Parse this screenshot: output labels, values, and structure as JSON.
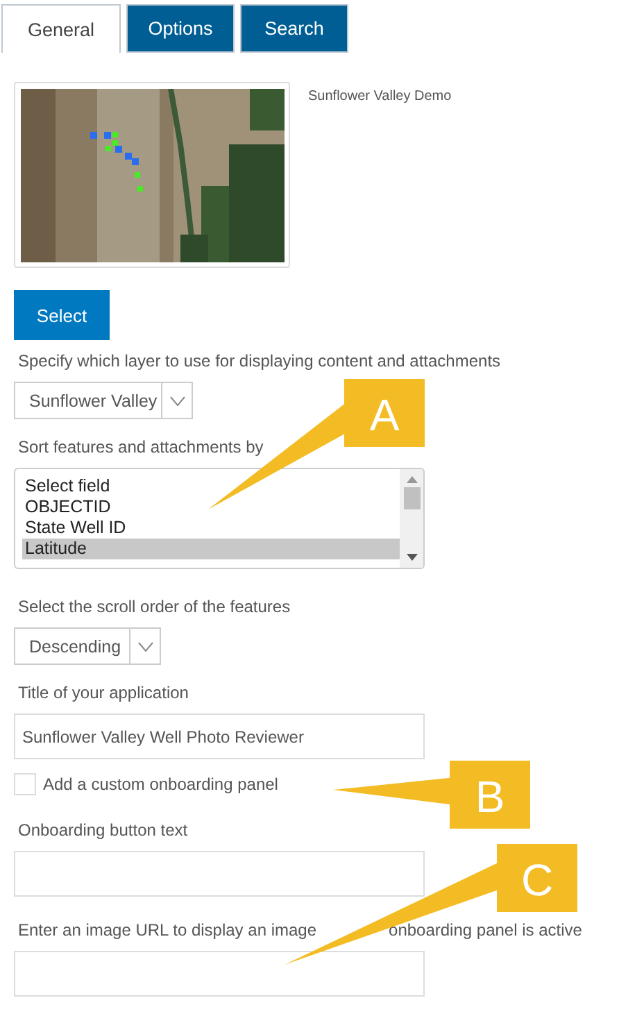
{
  "tabs": [
    {
      "label": "General",
      "selected": true
    },
    {
      "label": "Options",
      "selected": false
    },
    {
      "label": "Search",
      "selected": false
    }
  ],
  "webmap": {
    "title": "Sunflower Valley Demo"
  },
  "select_button": "Select",
  "layer": {
    "label": "Specify which layer to use for displaying content and attachments",
    "value": "Sunflower Valley"
  },
  "sort": {
    "label": "Sort features and attachments by",
    "options": [
      {
        "label": "Select field",
        "selected": false
      },
      {
        "label": "OBJECTID",
        "selected": false
      },
      {
        "label": "State Well ID",
        "selected": false
      },
      {
        "label": "Latitude",
        "selected": true
      }
    ]
  },
  "order": {
    "label": "Select the scroll order of the features",
    "value": "Descending"
  },
  "app_title": {
    "label": "Title of your application",
    "value": "Sunflower Valley Well Photo Reviewer"
  },
  "onboarding": {
    "label": "Add a custom onboarding panel",
    "checked": false
  },
  "button_text": {
    "label": "Onboarding button text"
  },
  "image_url": {
    "label_parts": [
      "Enter an image URL to display an image",
      "onboarding panel is active"
    ]
  },
  "callouts": [
    {
      "letter": "A"
    },
    {
      "letter": "B"
    },
    {
      "letter": "C"
    }
  ]
}
